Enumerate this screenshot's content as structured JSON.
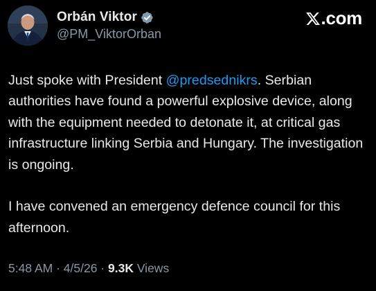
{
  "header": {
    "display_name": "Orbán Viktor",
    "handle": "@PM_ViktorOrban",
    "verified": true,
    "brand": ".com",
    "icons": [
      "avatar",
      "verified-badge-icon",
      "x-logo-icon"
    ]
  },
  "tweet": {
    "p1_before": "Just spoke with President ",
    "p1_mention": "@predsednikrs",
    "p1_after": ". Serbian authorities have found a powerful explosive device, along with the equipment needed to detonate it, at critical gas infrastructure linking Serbia and Hungary. The investigation is ongoing.",
    "p2": "I have convened an emergency defence council for this afternoon."
  },
  "meta": {
    "time": "5:48 AM",
    "separator": " · ",
    "date": "4/5/26",
    "views_count": "9.3K",
    "views_label": " Views"
  },
  "colors": {
    "background": "#000000",
    "text": "#e7e9ea",
    "secondary_text": "#8b98a5",
    "mention": "#1d9bf0",
    "verified_badge": "#829aab"
  }
}
